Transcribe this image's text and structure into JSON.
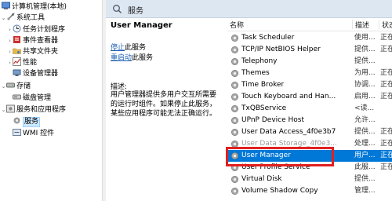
{
  "tree": {
    "root": "计算机管理(本地)",
    "system_tools": "系统工具",
    "task_scheduler": "任务计划程序",
    "event_viewer": "事件查看器",
    "shared_folders": "共享文件夹",
    "performance": "性能",
    "device_manager": "设备管理器",
    "storage": "存储",
    "disk_management": "磁盘管理",
    "services_apps": "服务和应用程序",
    "services": "服务",
    "wmi": "WMI 控件"
  },
  "header": {
    "title": "服务"
  },
  "description": {
    "service_name": "User Manager",
    "stop_link": "停止",
    "stop_suffix": "此服务",
    "restart_link": "重启动",
    "restart_suffix": "此服务",
    "desc_label": "描述:",
    "desc_text": "用户管理器提供多用户交互所需要的运行时组件。如果停止此服务，某些应用程序可能无法正确运行。"
  },
  "columns": {
    "name": "名称",
    "desc": "描述",
    "status": "状态"
  },
  "rows": [
    {
      "name": "Task Scheduler",
      "desc": "使用...",
      "status": "正在"
    },
    {
      "name": "TCP/IP NetBIOS Helper",
      "desc": "提供...",
      "status": "正在"
    },
    {
      "name": "Telephony",
      "desc": "提供...",
      "status": ""
    },
    {
      "name": "Themes",
      "desc": "为用...",
      "status": "正在"
    },
    {
      "name": "Time Broker",
      "desc": "协调...",
      "status": "正在"
    },
    {
      "name": "Touch Keyboard and Han...",
      "desc": "启用...",
      "status": "正在"
    },
    {
      "name": "TxQBService",
      "desc": "<读...",
      "status": ""
    },
    {
      "name": "UPnP Device Host",
      "desc": "允许...",
      "status": ""
    },
    {
      "name": "User Data Access_4f0e3b7",
      "desc": "提供...",
      "status": "正在"
    },
    {
      "name": "User Data Storage_4f0e3...",
      "desc": "处理...",
      "status": "正在"
    },
    {
      "name": "User Manager",
      "desc": "用户...",
      "status": "正在"
    },
    {
      "name": "User Profile Service",
      "desc": "此服...",
      "status": "正在"
    },
    {
      "name": "Virtual Disk",
      "desc": "提供...",
      "status": ""
    },
    {
      "name": "Volume Shadow Copy",
      "desc": "管理...",
      "status": ""
    }
  ],
  "colors": {
    "selection": "#0078d7",
    "highlight_box": "#e02020",
    "header_bg": "#dde7f2"
  }
}
